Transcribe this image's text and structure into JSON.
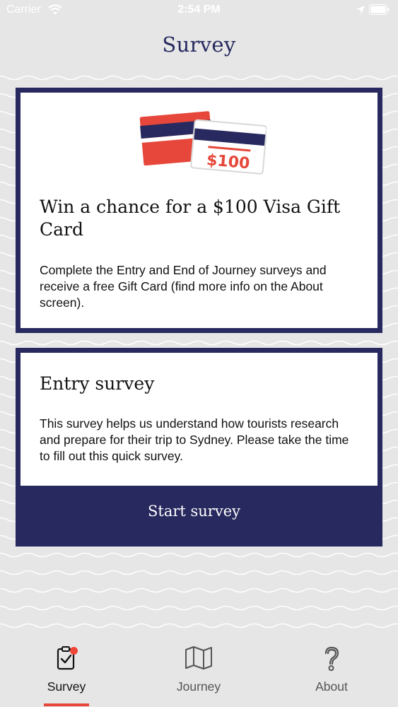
{
  "status_bar": {
    "carrier": "Carrier",
    "time": "2:54 PM"
  },
  "header": {
    "title": "Survey"
  },
  "prize_card": {
    "gift_card_amount": "$100",
    "heading": "Win a chance for a $100 Visa Gift Card",
    "body": "Complete the Entry and End of Journey surveys and receive a free Gift Card (find more info on the About screen)."
  },
  "survey_card": {
    "heading": "Entry survey",
    "body": "This survey helps us understand how tourists research and prepare for their trip to Sydney. Please take the time to fill out this quick survey.",
    "button_label": "Start survey"
  },
  "tabs": [
    {
      "label": "Survey",
      "icon": "clipboard-check-icon",
      "active": true,
      "badge": true
    },
    {
      "label": "Journey",
      "icon": "map-icon",
      "active": false
    },
    {
      "label": "About",
      "icon": "help-icon",
      "active": false
    }
  ],
  "colors": {
    "navy": "#27295f",
    "red": "#e6473a",
    "background": "#e6e6e6"
  }
}
